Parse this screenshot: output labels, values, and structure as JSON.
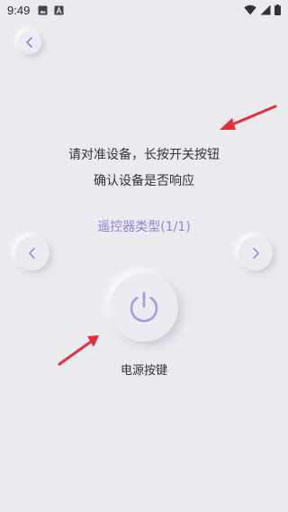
{
  "status_bar": {
    "time": "9:49",
    "icons": [
      "image-icon",
      "a-letter-icon",
      "wifi-icon",
      "signal-icon",
      "battery-icon"
    ]
  },
  "header": {
    "back_icon": "chevron-left-icon"
  },
  "instructions": {
    "line1": "请对准设备，长按开关按钮",
    "line2": "确认设备是否响应"
  },
  "remote_type": {
    "label": "遥控器类型(1/1)",
    "prev_icon": "chevron-left-icon",
    "next_icon": "chevron-right-icon"
  },
  "power": {
    "icon": "power-icon",
    "label": "电源按键"
  },
  "colors": {
    "accent": "#8f84d6",
    "background": "#ebeaef",
    "annotation_arrow": "#e0313b"
  }
}
